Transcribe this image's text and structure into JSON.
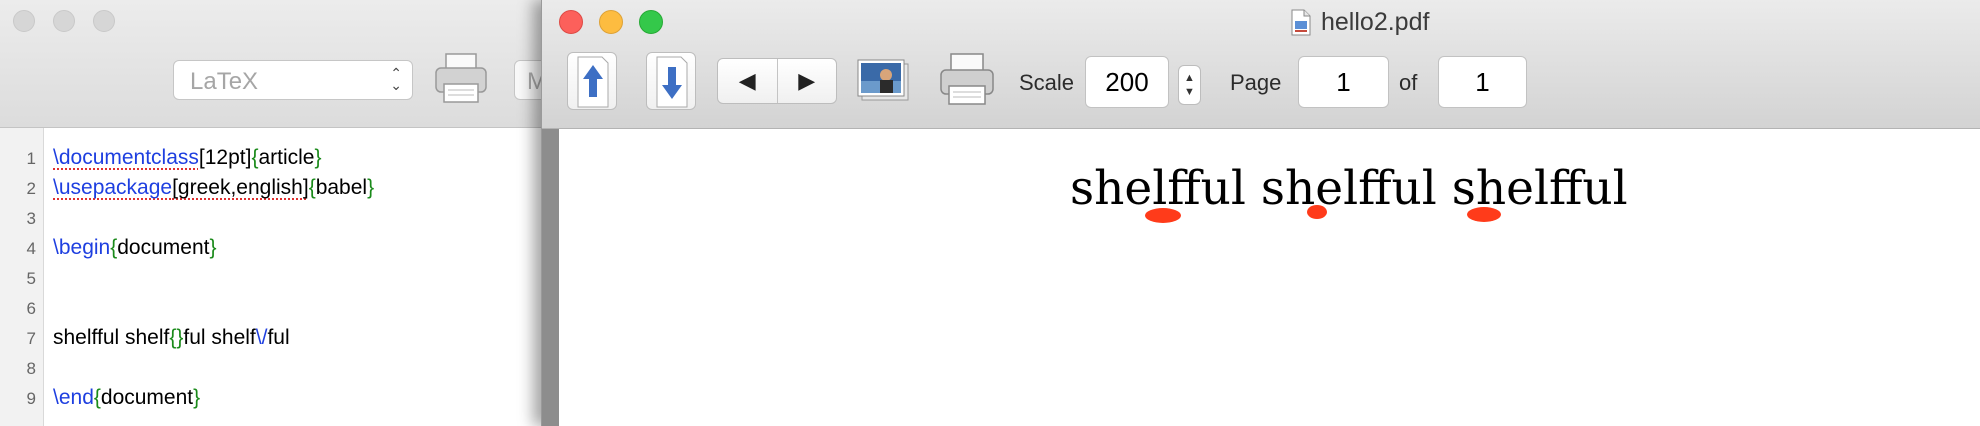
{
  "editor": {
    "typeset_select": "LaTeX",
    "cut_off_button_label": "M",
    "lines": [
      {
        "num": "1",
        "parts": [
          [
            "\\documentclass",
            "kw sq"
          ],
          [
            "[12pt]",
            ""
          ],
          [
            "{",
            "br"
          ],
          [
            "article",
            ""
          ],
          [
            "}",
            "br"
          ]
        ]
      },
      {
        "num": "2",
        "parts": [
          [
            "\\usepackage",
            "kw sq"
          ],
          [
            "[greek,english]",
            "sq"
          ],
          [
            "{",
            "br"
          ],
          [
            "babel",
            ""
          ],
          [
            "}",
            "br"
          ]
        ]
      },
      {
        "num": "3",
        "parts": []
      },
      {
        "num": "4",
        "parts": [
          [
            "\\begin",
            "kw"
          ],
          [
            "{",
            "br"
          ],
          [
            "document",
            ""
          ],
          [
            "}",
            "br"
          ]
        ]
      },
      {
        "num": "5",
        "parts": []
      },
      {
        "num": "6",
        "parts": []
      },
      {
        "num": "7",
        "parts": [
          [
            "shelfful shelf",
            ""
          ],
          [
            "{}",
            "br"
          ],
          [
            "ful shelf",
            ""
          ],
          [
            "\\/",
            "kw"
          ],
          [
            "ful",
            ""
          ]
        ]
      },
      {
        "num": "8",
        "parts": []
      },
      {
        "num": "9",
        "parts": [
          [
            "\\end",
            "kw"
          ],
          [
            "{",
            "br"
          ],
          [
            "document",
            ""
          ],
          [
            "}",
            "br"
          ]
        ]
      }
    ]
  },
  "pdf_window": {
    "title": "hello2.pdf",
    "scale_label": "Scale",
    "scale_value": "200",
    "page_label": "Page",
    "page_value": "1",
    "of_label": "of",
    "total_pages": "1",
    "nav_prev_icon": "◀",
    "nav_next_icon": "▶",
    "rendered_text": "shelfful shelfful shelfful",
    "highlight_color": "#ff3b1a"
  }
}
